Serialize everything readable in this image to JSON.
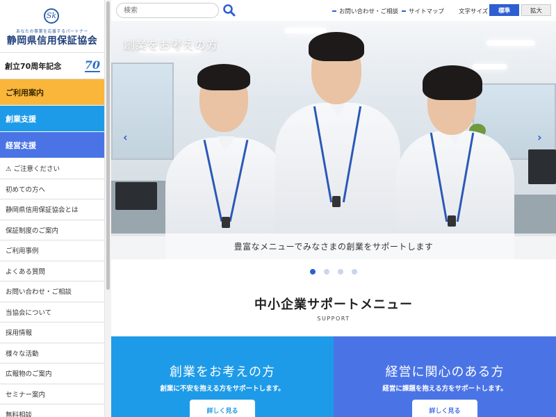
{
  "sidebar": {
    "logo_tagline": "あなたの事業を応援するパートナー",
    "logo_name": "静岡県信用保証協会",
    "anniversary_text": "創立70周年記念",
    "anniversary_badge": "70",
    "main_nav": [
      {
        "label": "ご利用案内"
      },
      {
        "label": "創業支援"
      },
      {
        "label": "経営支援"
      }
    ],
    "items": [
      {
        "label": "⚠ ご注意ください"
      },
      {
        "label": "初めての方へ"
      },
      {
        "label": "静岡県信用保証協会とは"
      },
      {
        "label": "保証制度のご案内"
      },
      {
        "label": "ご利用事例"
      },
      {
        "label": "よくある質問"
      },
      {
        "label": "お問い合わせ・ご相談"
      },
      {
        "label": "当協会について"
      },
      {
        "label": "採用情報"
      },
      {
        "label": "様々な活動"
      },
      {
        "label": "広報物のご案内"
      },
      {
        "label": "セミナー案内"
      },
      {
        "label": "無料相談"
      }
    ]
  },
  "header": {
    "search_placeholder": "検索",
    "link_contact": "お問い合わせ・ご相談",
    "link_sitemap": "サイトマップ",
    "font_size_label": "文字サイズ",
    "font_standard": "標準",
    "font_large": "拡大"
  },
  "hero": {
    "title": "創業をお考えの方",
    "caption": "豊富なメニューでみなさまの創業をサポートします",
    "prev_arrow": "‹",
    "next_arrow": "›"
  },
  "support": {
    "title": "中小企業サポートメニュー",
    "subtitle": "SUPPORT",
    "cards": [
      {
        "title": "創業をお考えの方",
        "desc": "創業に不安を抱える方をサポートします。",
        "button": "詳しく見る"
      },
      {
        "title": "経営に関心のある方",
        "desc": "経営に課題を抱える方をサポートします。",
        "button": "詳しく見る"
      }
    ]
  },
  "colors": {
    "guide": "#f9b63a",
    "startup": "#1e9be8",
    "management": "#4a74e6",
    "accent": "#2d5fd0"
  }
}
